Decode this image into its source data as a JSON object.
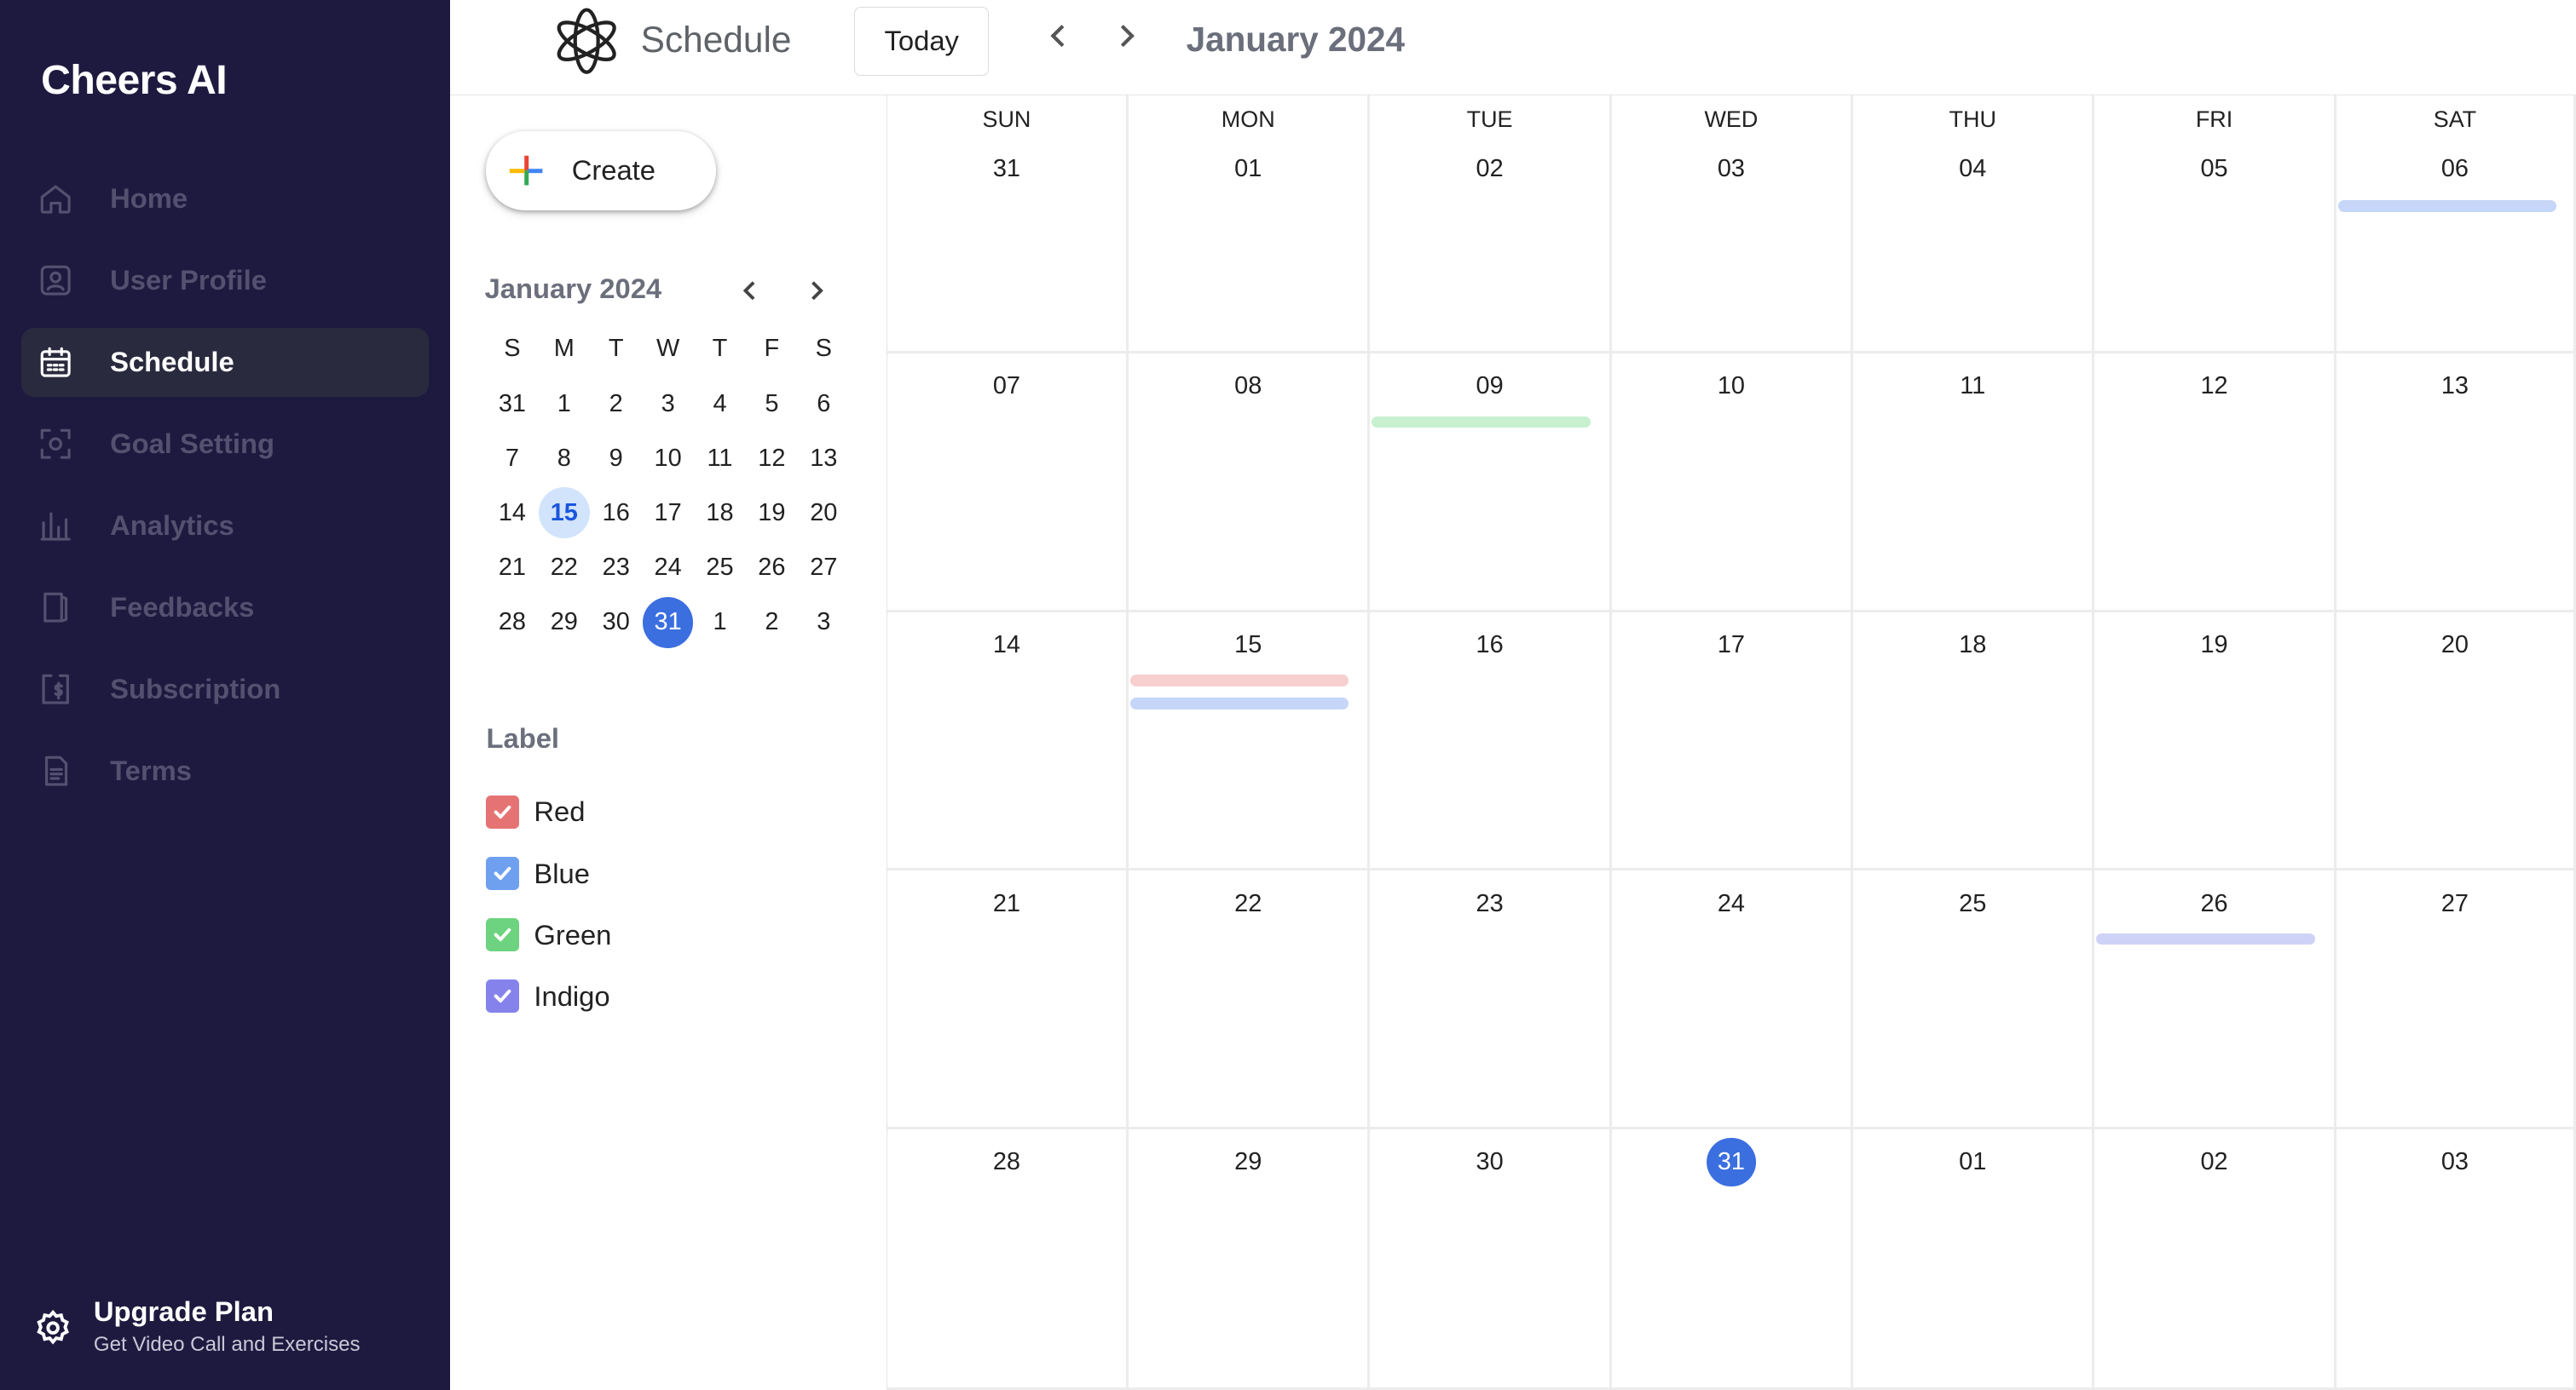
{
  "app": {
    "name": "Cheers AI"
  },
  "sidebar": {
    "items": [
      {
        "label": "Home",
        "icon": "home-icon",
        "active": false
      },
      {
        "label": "User Profile",
        "icon": "user-profile-icon",
        "active": false
      },
      {
        "label": "Schedule",
        "icon": "calendar-icon",
        "active": true
      },
      {
        "label": "Goal Setting",
        "icon": "target-icon",
        "active": false
      },
      {
        "label": "Analytics",
        "icon": "bar-chart-icon",
        "active": false
      },
      {
        "label": "Feedbacks",
        "icon": "feedback-icon",
        "active": false
      },
      {
        "label": "Subscription",
        "icon": "dollar-icon",
        "active": false
      },
      {
        "label": "Terms",
        "icon": "document-icon",
        "active": false
      }
    ],
    "upgrade": {
      "title": "Upgrade Plan",
      "subtitle": "Get Video Call and Exercises",
      "icon": "gear-icon"
    }
  },
  "header": {
    "title": "Schedule",
    "today_label": "Today",
    "month_label": "January 2024"
  },
  "create": {
    "label": "Create"
  },
  "mini_calendar": {
    "title": "January 2024",
    "weekdays": [
      "S",
      "M",
      "T",
      "W",
      "T",
      "F",
      "S"
    ],
    "weeks": [
      [
        31,
        1,
        2,
        3,
        4,
        5,
        6
      ],
      [
        7,
        8,
        9,
        10,
        11,
        12,
        13
      ],
      [
        14,
        15,
        16,
        17,
        18,
        19,
        20
      ],
      [
        21,
        22,
        23,
        24,
        25,
        26,
        27
      ],
      [
        28,
        29,
        30,
        31,
        1,
        2,
        3
      ]
    ],
    "highlighted": 15,
    "selected": 31
  },
  "labels": {
    "title": "Label",
    "items": [
      {
        "name": "Red",
        "color": "#e57373",
        "checked": true
      },
      {
        "name": "Blue",
        "color": "#6fa0f0",
        "checked": true
      },
      {
        "name": "Green",
        "color": "#6dd380",
        "checked": true
      },
      {
        "name": "Indigo",
        "color": "#8583eb",
        "checked": true
      }
    ]
  },
  "month_view": {
    "weekdays": [
      "SUN",
      "MON",
      "TUE",
      "WED",
      "THU",
      "FRI",
      "SAT"
    ],
    "weeks": [
      [
        "31",
        "01",
        "02",
        "03",
        "04",
        "05",
        "06"
      ],
      [
        "07",
        "08",
        "09",
        "10",
        "11",
        "12",
        "13"
      ],
      [
        "14",
        "15",
        "16",
        "17",
        "18",
        "19",
        "20"
      ],
      [
        "21",
        "22",
        "23",
        "24",
        "25",
        "26",
        "27"
      ],
      [
        "28",
        "29",
        "30",
        "31",
        "01",
        "02",
        "03"
      ]
    ],
    "today": {
      "week": 4,
      "day": 3
    },
    "events": [
      {
        "week": 0,
        "day": 6,
        "label": "Blue",
        "color": "#c5d6f8"
      },
      {
        "week": 1,
        "day": 2,
        "label": "Green",
        "color": "#c6f0cf"
      },
      {
        "week": 2,
        "day": 1,
        "label": "Red",
        "color": "#f7cfcf"
      },
      {
        "week": 2,
        "day": 1,
        "label": "Blue",
        "color": "#c5d6f8"
      },
      {
        "week": 3,
        "day": 5,
        "label": "Indigo",
        "color": "#cfd2f7"
      }
    ]
  }
}
